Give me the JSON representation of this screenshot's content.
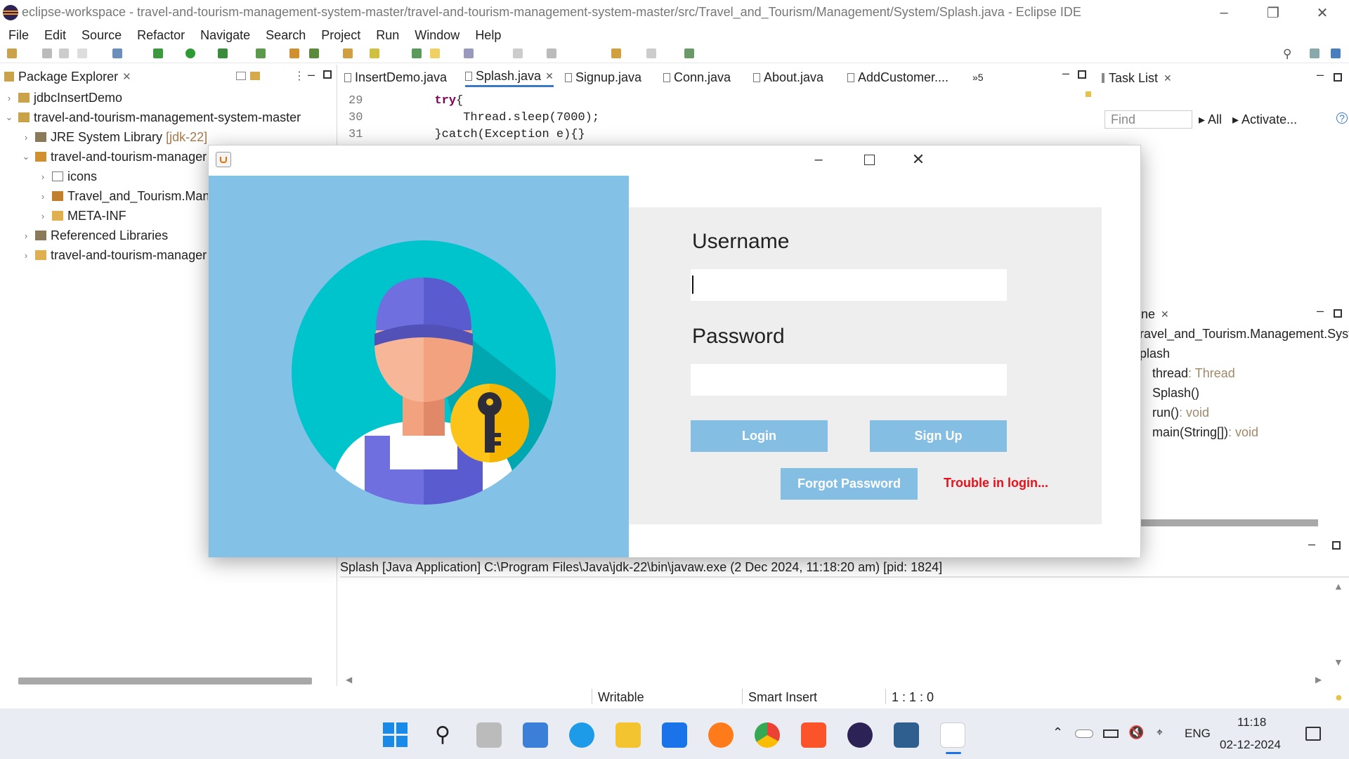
{
  "window": {
    "title": "eclipse-workspace - travel-and-tourism-management-system-master/travel-and-tourism-management-system-master/src/Travel_and_Tourism/Management/System/Splash.java - Eclipse IDE"
  },
  "menu": [
    "File",
    "Edit",
    "Source",
    "Refactor",
    "Navigate",
    "Search",
    "Project",
    "Run",
    "Window",
    "Help"
  ],
  "package_explorer": {
    "title": "Package Explorer",
    "items": [
      {
        "label": "jdbcInsertDemo",
        "extra": ""
      },
      {
        "label": "travel-and-tourism-management-system-master",
        "extra": ""
      },
      {
        "label": "JRE System Library",
        "extra": "[jdk-22]"
      },
      {
        "label": "travel-and-tourism-manager",
        "extra": ""
      },
      {
        "label": "icons",
        "extra": ""
      },
      {
        "label": "Travel_and_Tourism.Mana",
        "extra": ""
      },
      {
        "label": "META-INF",
        "extra": ""
      },
      {
        "label": "Referenced Libraries",
        "extra": ""
      },
      {
        "label": "travel-and-tourism-manager",
        "extra": ""
      }
    ]
  },
  "editor": {
    "tabs": [
      "InsertDemo.java",
      "Splash.java",
      "Signup.java",
      "Conn.java",
      "About.java",
      "AddCustomer....",
      "»5"
    ],
    "lines": [
      {
        "num": "29",
        "kw": "try",
        "rest": "{"
      },
      {
        "num": "30",
        "kw": "",
        "rest": "Thread.sleep(7000);"
      },
      {
        "num": "31",
        "kw": "",
        "rest": "}catch(Exception e){}"
      }
    ]
  },
  "task_list": {
    "title": "Task List",
    "find_placeholder": "Find",
    "all": "All",
    "activate": "Activate..."
  },
  "outline": {
    "tab": "ne",
    "items": [
      {
        "label": "ravel_and_Tourism.Management.Syste",
        "type": ""
      },
      {
        "label": "plash",
        "type": ""
      },
      {
        "label": "thread",
        "type": " : Thread"
      },
      {
        "label": "Splash()",
        "type": ""
      },
      {
        "label": "run()",
        "type": " : void"
      },
      {
        "label": "main(String[])",
        "type": " : void"
      }
    ]
  },
  "splash": {
    "username_label": "Username",
    "username_value": "",
    "password_label": "Password",
    "password_value": "",
    "login_button": "Login",
    "signup_button": "Sign Up",
    "forgot_button": "Forgot Password",
    "trouble_link": "Trouble in login..."
  },
  "console": {
    "header": "Splash [Java Application] C:\\Program Files\\Java\\jdk-22\\bin\\javaw.exe  (2 Dec 2024, 11:18:20 am) [pid: 1824]"
  },
  "status": {
    "writable": "Writable",
    "insert": "Smart Insert",
    "position": "1 : 1 : 0"
  },
  "taskbar": {
    "lang": "ENG",
    "time": "11:18",
    "date": "02-12-2024"
  },
  "colors": {
    "splash_left": "#84c1e6",
    "button": "#85bee3",
    "trouble": "#e8101a",
    "keyword": "#7f0055"
  }
}
